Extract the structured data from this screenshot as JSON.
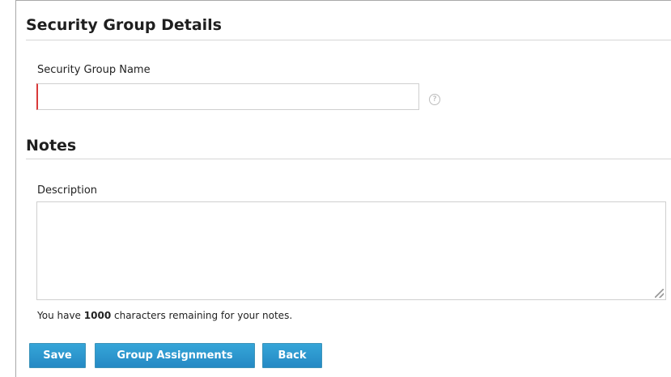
{
  "security_group_details": {
    "heading": "Security Group Details",
    "name_label": "Security Group Name",
    "name_value": "",
    "help_icon_glyph": "?"
  },
  "notes": {
    "heading": "Notes",
    "description_label": "Description",
    "description_value": "",
    "remaining_prefix": "You have ",
    "remaining_count": "1000",
    "remaining_suffix": " characters remaining for your notes."
  },
  "actions": {
    "save_label": "Save",
    "group_assignments_label": "Group Assignments",
    "back_label": "Back"
  },
  "colors": {
    "button_blue": "#2F98CF",
    "required_red": "#D93A3A",
    "border_gray": "#CFCFCF"
  },
  "icons": {
    "help": "help-circle-icon",
    "resize": "resize-grip-icon"
  }
}
